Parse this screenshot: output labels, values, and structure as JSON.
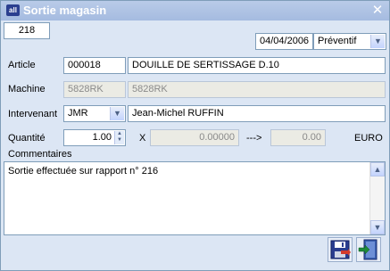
{
  "window": {
    "title": "Sortie magasin",
    "app_icon": "app-icon"
  },
  "header": {
    "number": "218",
    "date": "04/04/2006",
    "type": "Préventif"
  },
  "article": {
    "label": "Article",
    "code": "000018",
    "name": "DOUILLE DE SERTISSAGE D.10"
  },
  "machine": {
    "label": "Machine",
    "code": "5828RK",
    "name": "5828RK"
  },
  "intervenant": {
    "label": "Intervenant",
    "code": "JMR",
    "name": "Jean-Michel RUFFIN"
  },
  "quantite": {
    "label": "Quantité",
    "value": "1.00",
    "times": "X",
    "price": "0.00000",
    "arrow": "--->",
    "total": "0.00",
    "currency": "EURO"
  },
  "commentaires": {
    "label": "Commentaires",
    "text": "Sortie effectuée sur rapport n° 216"
  },
  "buttons": {
    "save_icon": "save-icon",
    "exit_icon": "exit-icon"
  }
}
